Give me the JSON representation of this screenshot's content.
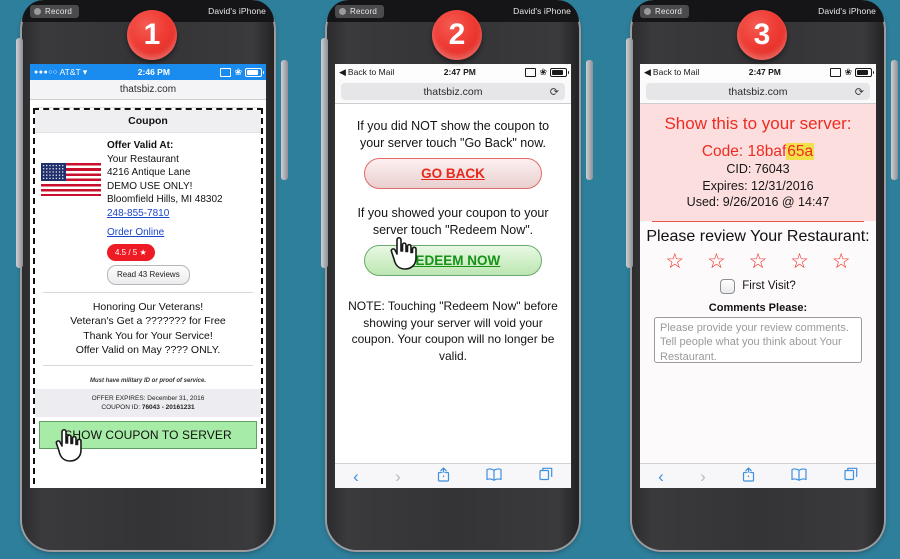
{
  "recorder": {
    "record_label": "Record",
    "device_label": "David's iPhone",
    "record_icon": "record-circle-icon"
  },
  "badges": {
    "one": "1",
    "two": "2",
    "three": "3"
  },
  "colors": {
    "background": "#2E7F9B",
    "badge_red": "#EE3B33",
    "status_blue": "#1A8CF0",
    "accent_red": "#EE2B22",
    "green_button": "#A6EBA6",
    "highlight_yellow": "#F2E04A",
    "link_blue": "#1A46C8"
  },
  "phone1": {
    "status_bar": {
      "carrier": "AT&T",
      "signal_dots": "●●●○○",
      "wifi_icon": "wifi-icon",
      "time": "2:46 PM",
      "airplay_icon": "airplay-icon",
      "bluetooth_icon": "bluetooth-icon",
      "battery_icon": "battery-icon"
    },
    "url": "thatsbiz.com",
    "coupon": {
      "title": "Coupon",
      "offer_heading": "Offer Valid At:",
      "business_name": "Your Restaurant",
      "address_line": "4216 Antique Lane",
      "demo_note": "DEMO USE ONLY!",
      "city_state_zip": "Bloomfield Hills, MI 48302",
      "phone": "248-855-7810",
      "order_online": "Order Online",
      "rating_badge": "4.5 / 5 ★",
      "reviews_button": "Read 43 Reviews",
      "flag_icon": "us-flag-icon",
      "promo_lines": [
        "Honoring Our Veterans!",
        "Veteran's Get a ??????? for Free",
        "Thank You for Your Service!",
        "Offer Valid on May ???? ONLY."
      ],
      "fine_print": "Must have military ID or proof of service.",
      "expires_label": "OFFER EXPIRES: December 31, 2016",
      "coupon_id_label": "COUPON ID: ",
      "coupon_id_value": "76043 - 20161231",
      "show_button": "SHOW COUPON TO SERVER",
      "cursor_icon": "hand-pointer-icon"
    }
  },
  "phone2": {
    "status_bar": {
      "back_label": "Back to Mail",
      "back_icon": "back-triangle-icon",
      "time": "2:47 PM",
      "airplay_icon": "airplay-icon",
      "bluetooth_icon": "bluetooth-icon",
      "battery_icon": "battery-icon"
    },
    "url": "thatsbiz.com",
    "reload_icon": "reload-icon",
    "para1": "If you did NOT show the coupon to your server touch \"Go Back\" now.",
    "go_back_button": "GO BACK",
    "para2": "If you showed your coupon to your server touch \"Redeem Now\".",
    "redeem_button": "REDEEM NOW",
    "note": "NOTE: Touching \"Redeem Now\" before showing your server will void your coupon. Your coupon will no longer be valid.",
    "cursor_icon": "hand-pointer-icon",
    "toolbar": {
      "back_icon": "chevron-left-icon",
      "forward_icon": "chevron-right-icon",
      "share_icon": "share-icon",
      "bookmarks_icon": "book-icon",
      "tabs_icon": "tabs-icon"
    }
  },
  "phone3": {
    "status_bar": {
      "back_label": "Back to Mail",
      "back_icon": "back-triangle-icon",
      "time": "2:47 PM",
      "airplay_icon": "airplay-icon",
      "bluetooth_icon": "bluetooth-icon",
      "battery_icon": "battery-icon"
    },
    "url": "thatsbiz.com",
    "reload_icon": "reload-icon",
    "show_heading": "Show this to your server:",
    "code_label": "Code: ",
    "code_plain": "18baf",
    "code_highlight": "65a",
    "cid": "CID: 76043",
    "expires": "Expires: 12/31/2016",
    "used": "Used: 9/26/2016 @ 14:47",
    "review_heading": "Please review Your Restaurant:",
    "stars": [
      "☆",
      "☆",
      "☆",
      "☆",
      "☆"
    ],
    "first_visit_label": "First Visit?",
    "comments_label": "Comments Please:",
    "comments_placeholder": "Please provide your review comments. Tell people what you think about Your Restaurant.",
    "toolbar": {
      "back_icon": "chevron-left-icon",
      "forward_icon": "chevron-right-icon",
      "share_icon": "share-icon",
      "bookmarks_icon": "book-icon",
      "tabs_icon": "tabs-icon"
    }
  }
}
